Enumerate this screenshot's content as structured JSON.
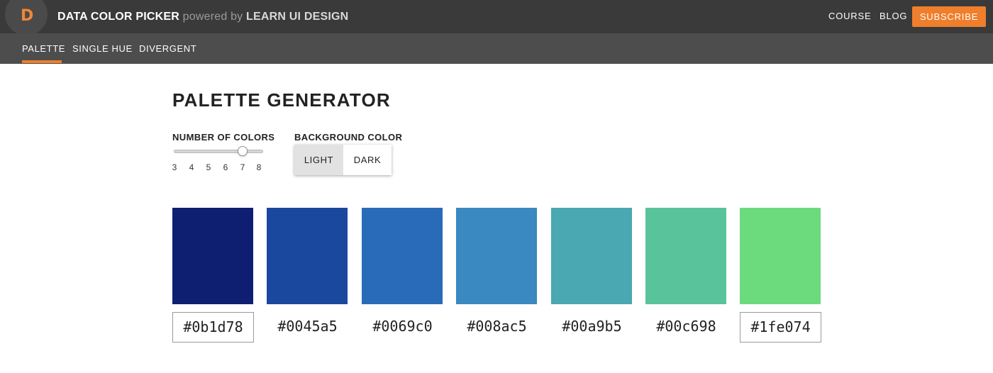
{
  "header": {
    "logo_letter": "D",
    "title": "DATA COLOR PICKER",
    "powered_by": "powered by",
    "brand": "LEARN UI DESIGN",
    "nav": {
      "course": "COURSE",
      "blog": "BLOG"
    },
    "subscribe_label": "SUBSCRIBE",
    "accent": "#ef7f2c"
  },
  "tabs": [
    {
      "label": "PALETTE",
      "active": true
    },
    {
      "label": "SINGLE HUE",
      "active": false
    },
    {
      "label": "DIVERGENT",
      "active": false
    }
  ],
  "page_title": "PALETTE GENERATOR",
  "number_of_colors": {
    "label": "NUMBER OF COLORS",
    "ticks": [
      "3",
      "4",
      "5",
      "6",
      "7",
      "8"
    ],
    "value": 7
  },
  "background_color": {
    "label": "BACKGROUND COLOR",
    "options": [
      "LIGHT",
      "DARK"
    ],
    "selected": "LIGHT"
  },
  "palette": [
    {
      "hex": "#0b1d78",
      "selected": true
    },
    {
      "hex": "#0045a5",
      "selected": false
    },
    {
      "hex": "#0069c0",
      "selected": false
    },
    {
      "hex": "#008ac5",
      "selected": false
    },
    {
      "hex": "#00a9b5",
      "selected": false
    },
    {
      "hex": "#00c698",
      "selected": false
    },
    {
      "hex": "#1fe074",
      "selected": true
    }
  ],
  "swatch_display_colors": [
    "#0e1f72",
    "#1a489f",
    "#2a6bb9",
    "#3a89c0",
    "#4aa8b2",
    "#59c49c",
    "#6bdb7e"
  ]
}
